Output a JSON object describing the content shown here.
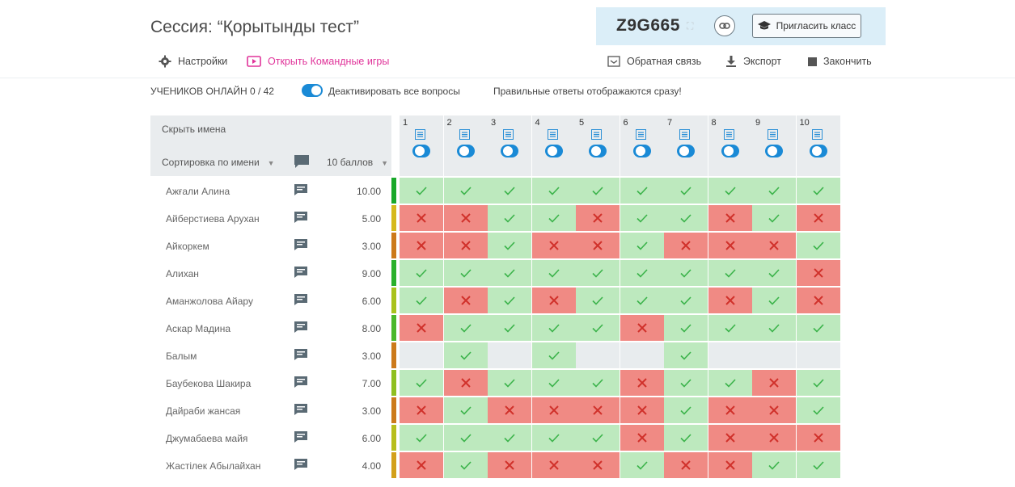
{
  "session": {
    "title": "Сессия: “Қорытынды тест”",
    "code": "Z9G665",
    "invite_label": "Пригласить класс"
  },
  "toolbar": {
    "settings": "Настройки",
    "team_games": "Открыть Командные игры",
    "feedback": "Обратная связь",
    "export": "Экспорт",
    "finish": "Закончить"
  },
  "status": {
    "online": "УЧЕНИКОВ ОНЛАЙН 0 / 42",
    "deactivate": "Деактивировать все вопросы",
    "answers_note": "Правильные ответы отображаются сразу!"
  },
  "table": {
    "hide_names": "Скрыть имена",
    "sort_label": "Сортировка по имени",
    "points_label": "10 баллов",
    "questions": [
      "1",
      "2",
      "3",
      "4",
      "5",
      "6",
      "7",
      "8",
      "9",
      "10"
    ]
  },
  "students": [
    {
      "name": "Ажғали Алина",
      "score": "10.00",
      "status_color": "#19a82a",
      "answers": [
        "c",
        "c",
        "c",
        "c",
        "c",
        "c",
        "c",
        "c",
        "c",
        "c"
      ]
    },
    {
      "name": "Айберстиева Арухан",
      "score": "5.00",
      "status_color": "#d6b91c",
      "answers": [
        "w",
        "w",
        "c",
        "c",
        "w",
        "c",
        "c",
        "w",
        "c",
        "w"
      ]
    },
    {
      "name": "Айкоркем",
      "score": "3.00",
      "status_color": "#cc7a1a",
      "answers": [
        "w",
        "w",
        "c",
        "w",
        "w",
        "c",
        "w",
        "w",
        "w",
        "c"
      ]
    },
    {
      "name": "Алихан",
      "score": "9.00",
      "status_color": "#2bb02b",
      "answers": [
        "c",
        "c",
        "c",
        "c",
        "c",
        "c",
        "c",
        "c",
        "c",
        "w"
      ]
    },
    {
      "name": "Аманжолова Айару",
      "score": "6.00",
      "status_color": "#a9c21c",
      "answers": [
        "c",
        "w",
        "c",
        "w",
        "c",
        "c",
        "c",
        "w",
        "c",
        "w"
      ]
    },
    {
      "name": "Аскар Мадина",
      "score": "8.00",
      "status_color": "#4bb82a",
      "answers": [
        "w",
        "c",
        "c",
        "c",
        "c",
        "w",
        "c",
        "c",
        "c",
        "c"
      ]
    },
    {
      "name": "Балым",
      "score": "3.00",
      "status_color": "#cc7a1a",
      "answers": [
        "e",
        "c",
        "e",
        "c",
        "e",
        "e",
        "c",
        "e",
        "e",
        "e"
      ]
    },
    {
      "name": "Баубекова Шакира",
      "score": "7.00",
      "status_color": "#8fbf20",
      "answers": [
        "c",
        "w",
        "c",
        "c",
        "c",
        "w",
        "c",
        "c",
        "w",
        "c"
      ]
    },
    {
      "name": "Дайраби жансая",
      "score": "3.00",
      "status_color": "#cc7a1a",
      "answers": [
        "w",
        "c",
        "w",
        "w",
        "w",
        "w",
        "c",
        "w",
        "w",
        "c"
      ]
    },
    {
      "name": "Джумабаева майя",
      "score": "6.00",
      "status_color": "#b7be1c",
      "answers": [
        "c",
        "c",
        "c",
        "c",
        "c",
        "w",
        "c",
        "w",
        "w",
        "w"
      ]
    },
    {
      "name": "Жастілек Абылайхан",
      "score": "4.00",
      "status_color": "#d3a01a",
      "answers": [
        "w",
        "c",
        "w",
        "w",
        "w",
        "c",
        "w",
        "w",
        "c",
        "c"
      ]
    }
  ],
  "colors": {
    "correct_bg": "#bde9be",
    "correct_mark": "#3bb34a",
    "wrong_bg": "#f08a84",
    "wrong_mark": "#d0312b",
    "empty_bg": "#e8ecee",
    "accent_blue": "#1a8ad6",
    "team_games_pink": "#e0349a"
  }
}
